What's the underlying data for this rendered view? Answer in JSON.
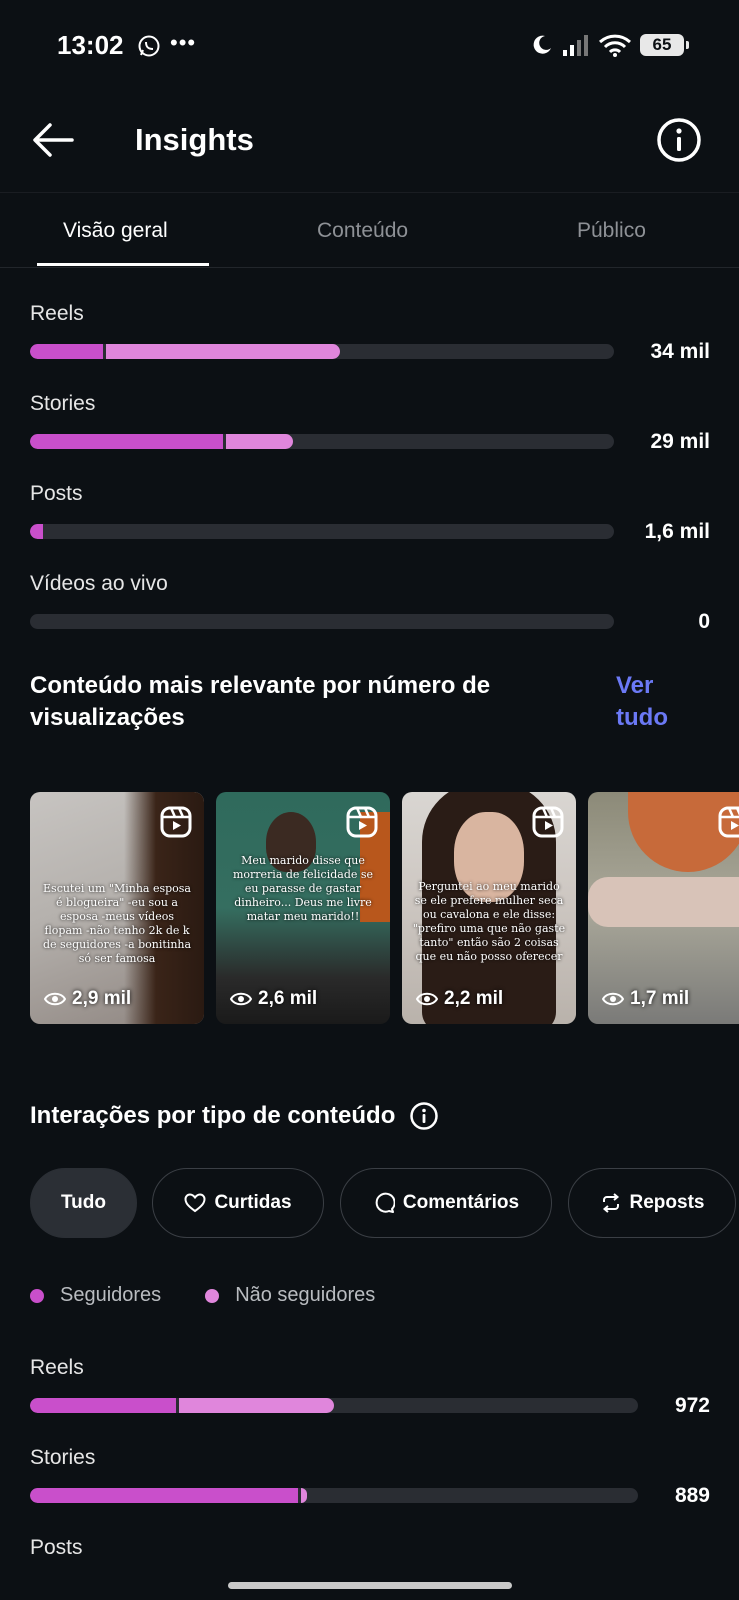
{
  "status": {
    "time": "13:02",
    "battery": "65"
  },
  "header": {
    "title": "Insights"
  },
  "tabs": [
    {
      "label": "Visão geral",
      "active": true
    },
    {
      "label": "Conteúdo",
      "active": false
    },
    {
      "label": "Público",
      "active": false
    }
  ],
  "views_by_type": [
    {
      "label": "Reels",
      "value": "34 mil",
      "followers_pct": 0.125,
      "non_followers_pct": 0.405
    },
    {
      "label": "Stories",
      "value": "29 mil",
      "followers_pct": 0.33,
      "non_followers_pct": 0.12
    },
    {
      "label": "Posts",
      "value": "1,6 mil",
      "followers_pct": 0.022,
      "non_followers_pct": 0.004
    },
    {
      "label": "Vídeos ao vivo",
      "value": "0",
      "followers_pct": 0.0,
      "non_followers_pct": 0.0
    }
  ],
  "top_content": {
    "title": "Conteúdo mais relevante por número de visualizações",
    "see_all": "Ver tudo",
    "items": [
      {
        "views": "2,9 mil",
        "caption": "Escutei um \"Minha esposa é blogueira\" -eu sou a esposa -meus vídeos flopam -não tenho 2k de k de seguidores -a bonitinha só ser famosa"
      },
      {
        "views": "2,6 mil",
        "caption": "Meu marido disse que morreria de felicidade se eu parasse de gastar dinheiro... Deus me livre matar meu marido!!"
      },
      {
        "views": "2,2 mil",
        "caption": "Perguntei ao meu marido se ele prefere mulher seca ou cavalona e ele disse: \"prefiro uma que não gaste tanto\" então são 2 coisas que eu não posso oferecer"
      },
      {
        "views": "1,7 mil",
        "caption": ""
      }
    ]
  },
  "interactions": {
    "title": "Interações por tipo de conteúdo",
    "filters": [
      {
        "label": "Tudo",
        "icon": "",
        "active": true
      },
      {
        "label": "Curtidas",
        "icon": "heart-icon",
        "active": false
      },
      {
        "label": "Comentários",
        "icon": "comment-icon",
        "active": false
      },
      {
        "label": "Reposts",
        "icon": "repost-icon",
        "active": false
      }
    ],
    "legend": [
      {
        "label": "Seguidores",
        "color": "#c94fcb"
      },
      {
        "label": "Não seguidores",
        "color": "#e086dc"
      }
    ],
    "rows": [
      {
        "label": "Reels",
        "value": "972",
        "followers_pct": 0.24,
        "non_followers_pct": 0.26
      },
      {
        "label": "Stories",
        "value": "889",
        "followers_pct": 0.44,
        "non_followers_pct": 0.015
      },
      {
        "label": "Posts",
        "value": ""
      }
    ]
  },
  "colors": {
    "followers": "#c94fcb",
    "non_followers": "#e086dc",
    "link": "#6b79f5"
  }
}
